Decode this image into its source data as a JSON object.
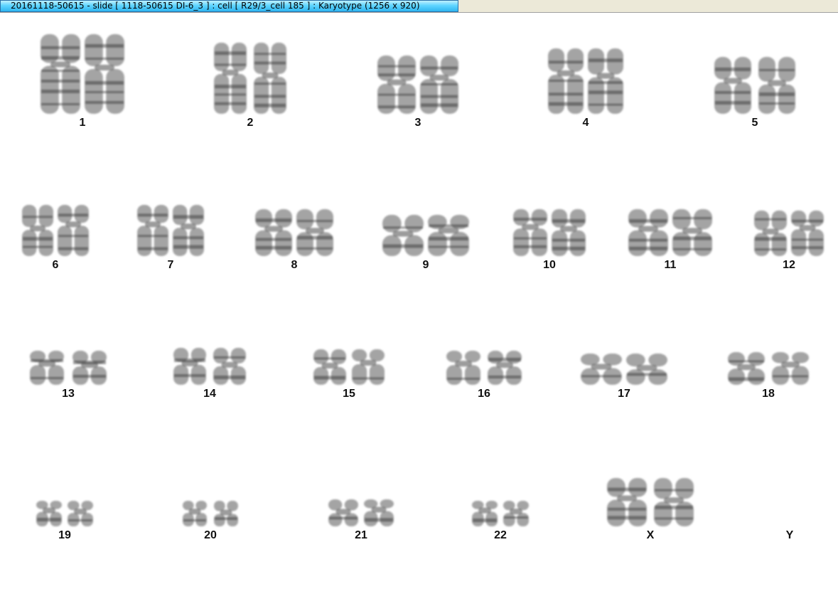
{
  "window": {
    "title": "20161118-50615 - slide [ 1118-50615 DI-6_3 ] : cell [ R29/3_cell 185 ] : Karyotype  (1256 x 920)"
  },
  "karyotype": {
    "chromosome_color": "#5a5a5a",
    "band_color": "#2a2a2a",
    "pairs": [
      {
        "label": "1"
      },
      {
        "label": "2"
      },
      {
        "label": "3"
      },
      {
        "label": "4"
      },
      {
        "label": "5"
      },
      {
        "label": "6"
      },
      {
        "label": "7"
      },
      {
        "label": "8"
      },
      {
        "label": "9"
      },
      {
        "label": "10"
      },
      {
        "label": "11"
      },
      {
        "label": "12"
      },
      {
        "label": "13"
      },
      {
        "label": "14"
      },
      {
        "label": "15"
      },
      {
        "label": "16"
      },
      {
        "label": "17"
      },
      {
        "label": "18"
      },
      {
        "label": "19"
      },
      {
        "label": "20"
      },
      {
        "label": "21"
      },
      {
        "label": "22"
      },
      {
        "label": "X"
      },
      {
        "label": "Y"
      }
    ]
  }
}
